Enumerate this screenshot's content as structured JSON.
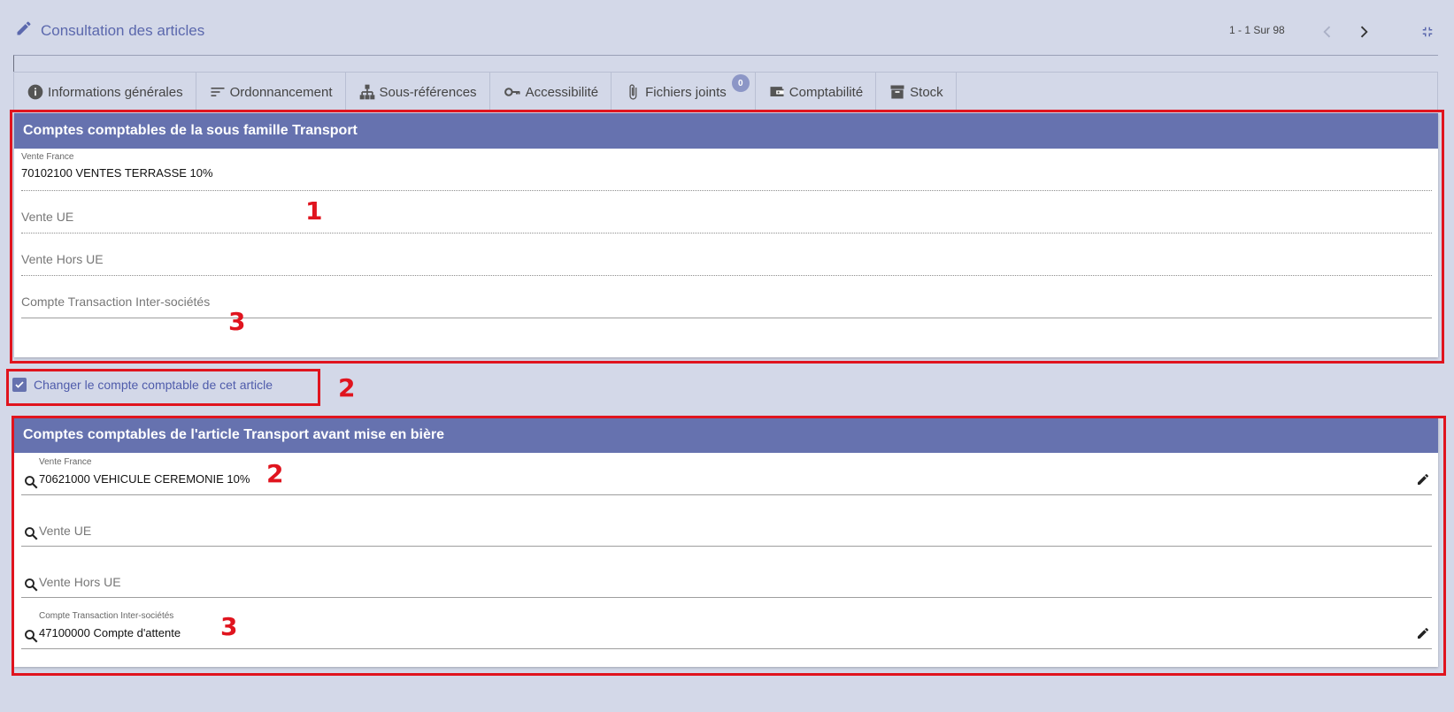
{
  "header": {
    "title": "Consultation des articles",
    "pager": "1 - 1 Sur 98"
  },
  "tabs": [
    {
      "label": "Informations générales",
      "icon": "info-icon"
    },
    {
      "label": "Ordonnancement",
      "icon": "sort-icon"
    },
    {
      "label": "Sous-références",
      "icon": "hierarchy-icon"
    },
    {
      "label": "Accessibilité",
      "icon": "key-icon"
    },
    {
      "label": "Fichiers joints",
      "icon": "paperclip-icon",
      "badge": "0"
    },
    {
      "label": "Comptabilité",
      "icon": "wallet-icon"
    },
    {
      "label": "Stock",
      "icon": "archive-icon"
    }
  ],
  "panel1": {
    "title": "Comptes comptables de la sous famille Transport",
    "fields": [
      {
        "label": "Vente France",
        "value": "70102100 VENTES TERRASSE 10%"
      },
      {
        "label": "Vente UE",
        "value": ""
      },
      {
        "label": "Vente Hors UE",
        "value": ""
      },
      {
        "label": "Compte Transaction Inter-sociétés",
        "value": ""
      }
    ]
  },
  "checkbox": {
    "label": "Changer le compte comptable de cet article",
    "checked": true
  },
  "panel2": {
    "title": "Comptes comptables de l'article Transport avant mise en bière",
    "fields": [
      {
        "label": "Vente France",
        "value": "70621000 VEHICULE CEREMONIE 10%"
      },
      {
        "label": "Vente UE",
        "value": ""
      },
      {
        "label": "Vente Hors UE",
        "value": ""
      },
      {
        "label": "Compte Transaction Inter-sociétés",
        "value": "47100000 Compte d'attente"
      }
    ]
  },
  "callouts": [
    "1",
    "2",
    "3",
    "2",
    "3"
  ],
  "colors": {
    "accent": "#6672af",
    "background": "#d3d8e8",
    "annotation": "#e0141e"
  }
}
